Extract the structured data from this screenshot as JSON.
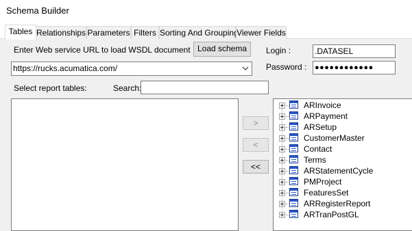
{
  "window": {
    "title": "Schema Builder"
  },
  "tabs": [
    {
      "label": "Tables",
      "active": true
    },
    {
      "label": "Relationships",
      "active": false
    },
    {
      "label": "Parameters",
      "active": false
    },
    {
      "label": "Filters",
      "active": false
    },
    {
      "label": "Sorting And Grouping",
      "active": false
    },
    {
      "label": "Viewer Fields",
      "active": false
    }
  ],
  "wsdl": {
    "label": "Enter Web service URL to load WSDL document :",
    "load_button": "Load schema",
    "url_value": "https://rucks.acumatica.com/"
  },
  "login": {
    "label": "Login :",
    "value": ".DATASEL"
  },
  "password": {
    "label": "Password :",
    "value": "●●●●●●●●●●●●"
  },
  "report_tables": {
    "label": "Select report tables:"
  },
  "search": {
    "label": "Search:",
    "value": ""
  },
  "move_buttons": {
    "add": ">",
    "remove": "<",
    "remove_all": "<<"
  },
  "tree_items": [
    "ARInvoice",
    "ARPayment",
    "ARSetup",
    "CustomerMaster",
    "Contact",
    "Terms",
    "ARStatementCycle",
    "PMProject",
    "FeaturesSet",
    "ARRegisterReport",
    "ARTranPostGL"
  ],
  "icons": {
    "expander": "plus-expander-icon",
    "table": "table-icon",
    "dropdown": "chevron-down-icon"
  }
}
